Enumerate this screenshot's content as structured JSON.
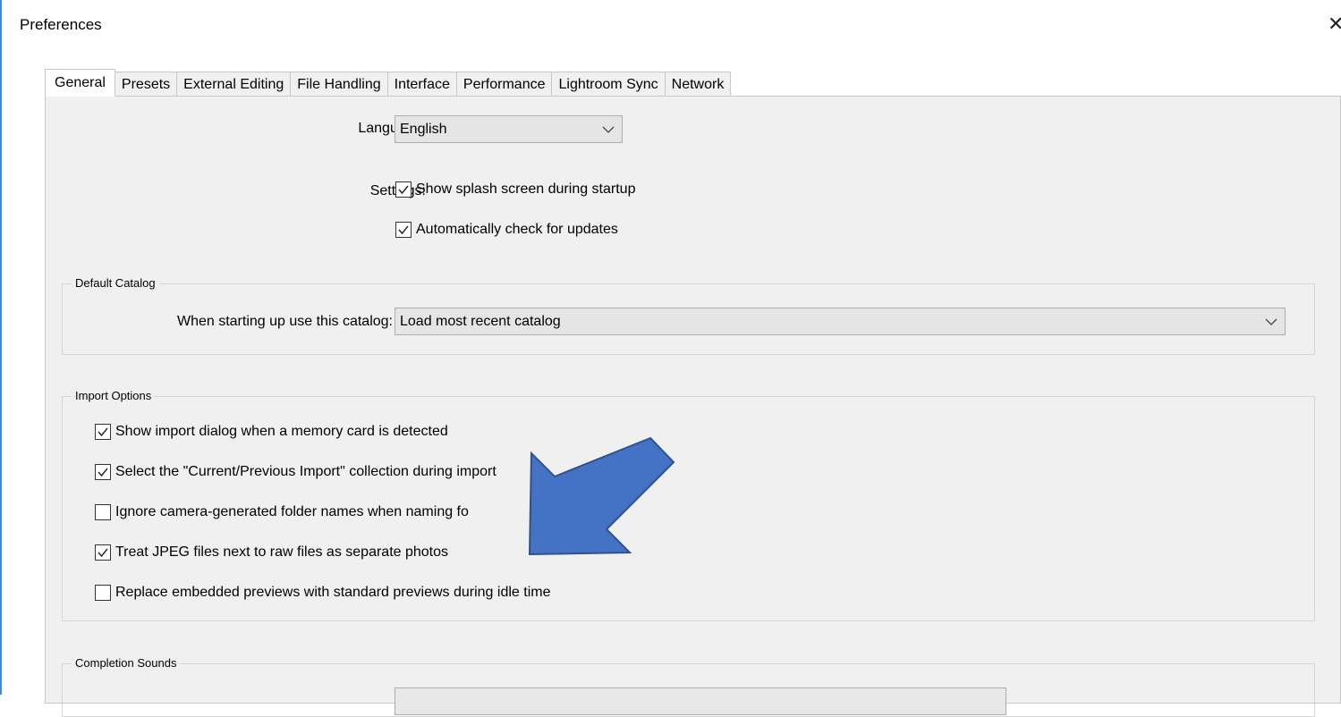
{
  "window": {
    "title": "Preferences",
    "close_icon": "close-icon"
  },
  "tabs": [
    {
      "label": "General",
      "active": true
    },
    {
      "label": "Presets"
    },
    {
      "label": "External Editing"
    },
    {
      "label": "File Handling"
    },
    {
      "label": "Interface"
    },
    {
      "label": "Performance"
    },
    {
      "label": "Lightroom Sync"
    },
    {
      "label": "Network"
    }
  ],
  "general": {
    "language": {
      "label": "Language:",
      "value": "English"
    },
    "settings": {
      "label": "Settings:",
      "options": [
        {
          "label": "Show splash screen during startup",
          "checked": true
        },
        {
          "label": "Automatically check for updates",
          "checked": true
        }
      ]
    },
    "default_catalog": {
      "legend": "Default Catalog",
      "label": "When starting up use this catalog:",
      "value": "Load most recent catalog"
    },
    "import_options": {
      "legend": "Import Options",
      "options": [
        {
          "label": "Show import dialog when a memory card is detected",
          "checked": true
        },
        {
          "label": "Select the \"Current/Previous Import\" collection during import",
          "checked": true
        },
        {
          "label": "Ignore camera-generated folder names when naming fo",
          "checked": false
        },
        {
          "label": "Treat JPEG files next to raw files as separate photos",
          "checked": true
        },
        {
          "label": "Replace embedded previews with standard previews during idle time",
          "checked": false
        }
      ]
    },
    "completion_sounds": {
      "legend": "Completion Sounds"
    }
  },
  "annotation": {
    "color": "#4472c4",
    "border_color": "#2f528f"
  }
}
